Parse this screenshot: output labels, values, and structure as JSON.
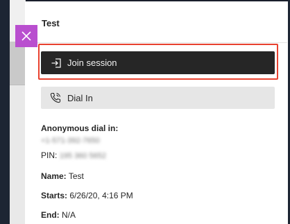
{
  "dialog": {
    "title": "Test",
    "close_icon": "close-icon",
    "join_button_label": "Join session",
    "join_icon": "sign-in-icon",
    "dial_button_label": "Dial In",
    "dial_icon": "phone-icon"
  },
  "details": {
    "anonymous_label": "Anonymous dial in:",
    "phone_number": "+1-571-392-7650",
    "pin_label": "PIN:",
    "pin_value": "195 360 5652",
    "name_label": "Name:",
    "name_value": "Test",
    "starts_label": "Starts:",
    "starts_value": "6/26/20, 4:16 PM",
    "end_label": "End:",
    "end_value": "N/A"
  },
  "colors": {
    "accent_close": "#b94fcf",
    "highlight_border": "#e8412f",
    "join_bg": "#262626",
    "dial_bg": "#e6e6e6"
  }
}
